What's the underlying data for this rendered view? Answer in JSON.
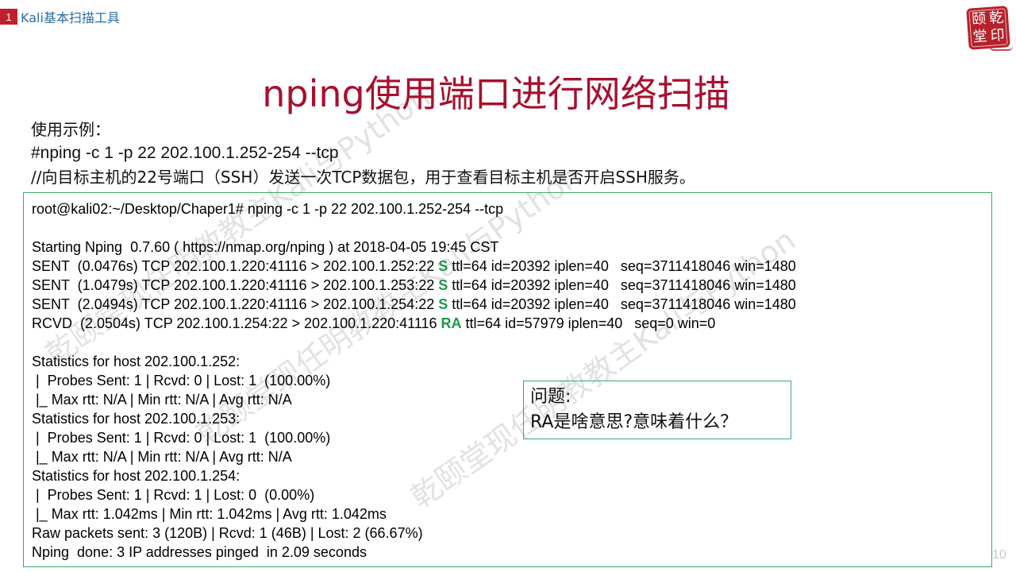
{
  "header": {
    "section_number": "1",
    "section_title": "Kali基本扫描工具"
  },
  "logo": {
    "chars": [
      "颐",
      "乾",
      "堂",
      "印"
    ]
  },
  "title": "nping使用端口进行网络扫描",
  "intro": {
    "label": "使用示例：",
    "command": "#nping -c 1 -p 22 202.100.1.252-254  --tcp",
    "description": "//向目标主机的22号端口（SSH）发送一次TCP数据包，用于查看目标主机是否开启SSH服务。"
  },
  "terminal": {
    "lines": [
      {
        "text": "root@kali02:~/Desktop/Chaper1# nping -c 1 -p 22 202.100.1.252-254 --tcp"
      },
      {
        "text": ""
      },
      {
        "text": "Starting Nping  0.7.60 ( https://nmap.org/nping ) at 2018-04-05 19:45 CST"
      },
      {
        "pre": "SENT  (0.0476s) TCP 202.100.1.220:41116 > 202.100.1.252:22 ",
        "flag": "S",
        "post": " ttl=64 id=20392 iplen=40   seq=3711418046 win=1480"
      },
      {
        "pre": "SENT  (1.0479s) TCP 202.100.1.220:41116 > 202.100.1.253:22 ",
        "flag": "S",
        "post": " ttl=64 id=20392 iplen=40   seq=3711418046 win=1480"
      },
      {
        "pre": "SENT  (2.0494s) TCP 202.100.1.220:41116 > 202.100.1.254:22 ",
        "flag": "S",
        "post": " ttl=64 id=20392 iplen=40   seq=3711418046 win=1480"
      },
      {
        "pre": "RCVD  (2.0504s) TCP 202.100.1.254:22 > 202.100.1.220:41116 ",
        "flag": "RA",
        "post": " ttl=64 id=57979 iplen=40   seq=0 win=0"
      },
      {
        "text": ""
      },
      {
        "text": "Statistics for host 202.100.1.252:"
      },
      {
        "text": " |  Probes Sent: 1 | Rcvd: 0 | Lost: 1  (100.00%)"
      },
      {
        "text": " |_ Max rtt: N/A | Min rtt: N/A | Avg rtt: N/A"
      },
      {
        "text": "Statistics for host 202.100.1.253:"
      },
      {
        "text": " |  Probes Sent: 1 | Rcvd: 0 | Lost: 1  (100.00%)"
      },
      {
        "text": " |_ Max rtt: N/A | Min rtt: N/A | Avg rtt: N/A"
      },
      {
        "text": "Statistics for host 202.100.1.254:"
      },
      {
        "text": " |  Probes Sent: 1 | Rcvd: 1 | Lost: 0  (0.00%)"
      },
      {
        "text": " |_ Max rtt: 1.042ms | Min rtt: 1.042ms | Avg rtt: 1.042ms"
      },
      {
        "text": "Raw packets sent: 3 (120B) | Rcvd: 1 (46B) | Lost: 2 (66.67%)"
      },
      {
        "text": "Nping  done: 3 IP addresses pinged  in 2.09 seconds"
      }
    ]
  },
  "question": {
    "line1": "问题:",
    "line2": "RA是啥意思?意味着什么？"
  },
  "page_number": "10",
  "colors": {
    "title": "#a8102e",
    "flag": "#1a9a4a",
    "border": "#3aa86a",
    "badge": "#c0202c"
  }
}
